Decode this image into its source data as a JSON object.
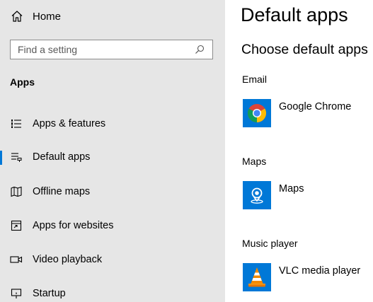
{
  "sidebar": {
    "home_label": "Home",
    "search_placeholder": "Find a setting",
    "section_heading": "Apps",
    "items": [
      {
        "label": "Apps & features",
        "icon": "list-icon",
        "selected": false
      },
      {
        "label": "Default apps",
        "icon": "default-apps-icon",
        "selected": true
      },
      {
        "label": "Offline maps",
        "icon": "map-icon",
        "selected": false
      },
      {
        "label": "Apps for websites",
        "icon": "open-in-app-icon",
        "selected": false
      },
      {
        "label": "Video playback",
        "icon": "video-icon",
        "selected": false
      },
      {
        "label": "Startup",
        "icon": "startup-icon",
        "selected": false
      }
    ]
  },
  "main": {
    "title": "Default apps",
    "subtitle": "Choose default apps",
    "categories": [
      {
        "label": "Email",
        "app": "Google Chrome",
        "app_icon": "chrome-icon"
      },
      {
        "label": "Maps",
        "app": "Maps",
        "app_icon": "maps-app-icon"
      },
      {
        "label": "Music player",
        "app": "VLC media player",
        "app_icon": "vlc-icon"
      }
    ]
  },
  "colors": {
    "accent": "#0078d7",
    "sidebar_bg": "#e6e6e6",
    "main_bg": "#ffffff"
  }
}
